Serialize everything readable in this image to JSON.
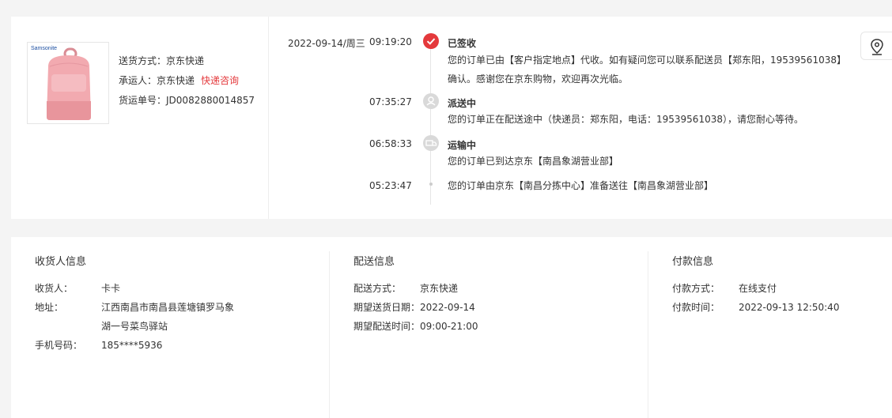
{
  "shipping": {
    "method_label": "送货方式：",
    "method_value": "京东快递",
    "carrier_label": "承运人：",
    "carrier_value": "京东快递",
    "carrier_link": "快递咨询",
    "tracking_label": "货运单号：",
    "tracking_value": "JD0082880014857",
    "product_brand": "Samsonite"
  },
  "timeline": {
    "date": "2022-09-14/周三",
    "events": [
      {
        "time": "09:19:20",
        "status": "已签收",
        "desc": "您的订单已由【客户指定地点】代收。如有疑问您可以联系配送员【郑东阳，19539561038】确认。感谢您在京东购物，欢迎再次光临。"
      },
      {
        "time": "07:35:27",
        "status": "派送中",
        "desc": "您的订单正在配送途中（快递员：郑东阳，电话：19539561038），请您耐心等待。"
      },
      {
        "time": "06:58:33",
        "status": "运输中",
        "desc": "您的订单已到达京东【南昌象湖营业部】"
      },
      {
        "time": "05:23:47",
        "status": "",
        "desc": "您的订单由京东【南昌分拣中心】准备送往【南昌象湖营业部】"
      }
    ]
  },
  "receiver": {
    "title": "收货人信息",
    "name_label": "收货人：",
    "name_value": "卡卡",
    "address_label": "地址：",
    "address_line1": "江西南昌市南昌县莲塘镇罗马象",
    "address_line2": "湖一号菜鸟驿站",
    "phone_label": "手机号码：",
    "phone_value": "185****5936"
  },
  "delivery": {
    "title": "配送信息",
    "method_label": "配送方式：",
    "method_value": "京东快递",
    "date_label": "期望送货日期：",
    "date_value": "2022-09-14",
    "time_label": "期望配送时间：",
    "time_value": "09:00-21:00"
  },
  "payment": {
    "title": "付款信息",
    "method_label": "付款方式：",
    "method_value": "在线支付",
    "time_label": "付款时间：",
    "time_value": "2022-09-13 12:50:40"
  },
  "colors": {
    "accent": "#e4393c",
    "node_grey": "#d9d9d9"
  },
  "icons": {
    "map": "map-pin-icon",
    "signed": "check-icon",
    "delivering": "courier-icon",
    "transit": "truck-icon"
  }
}
